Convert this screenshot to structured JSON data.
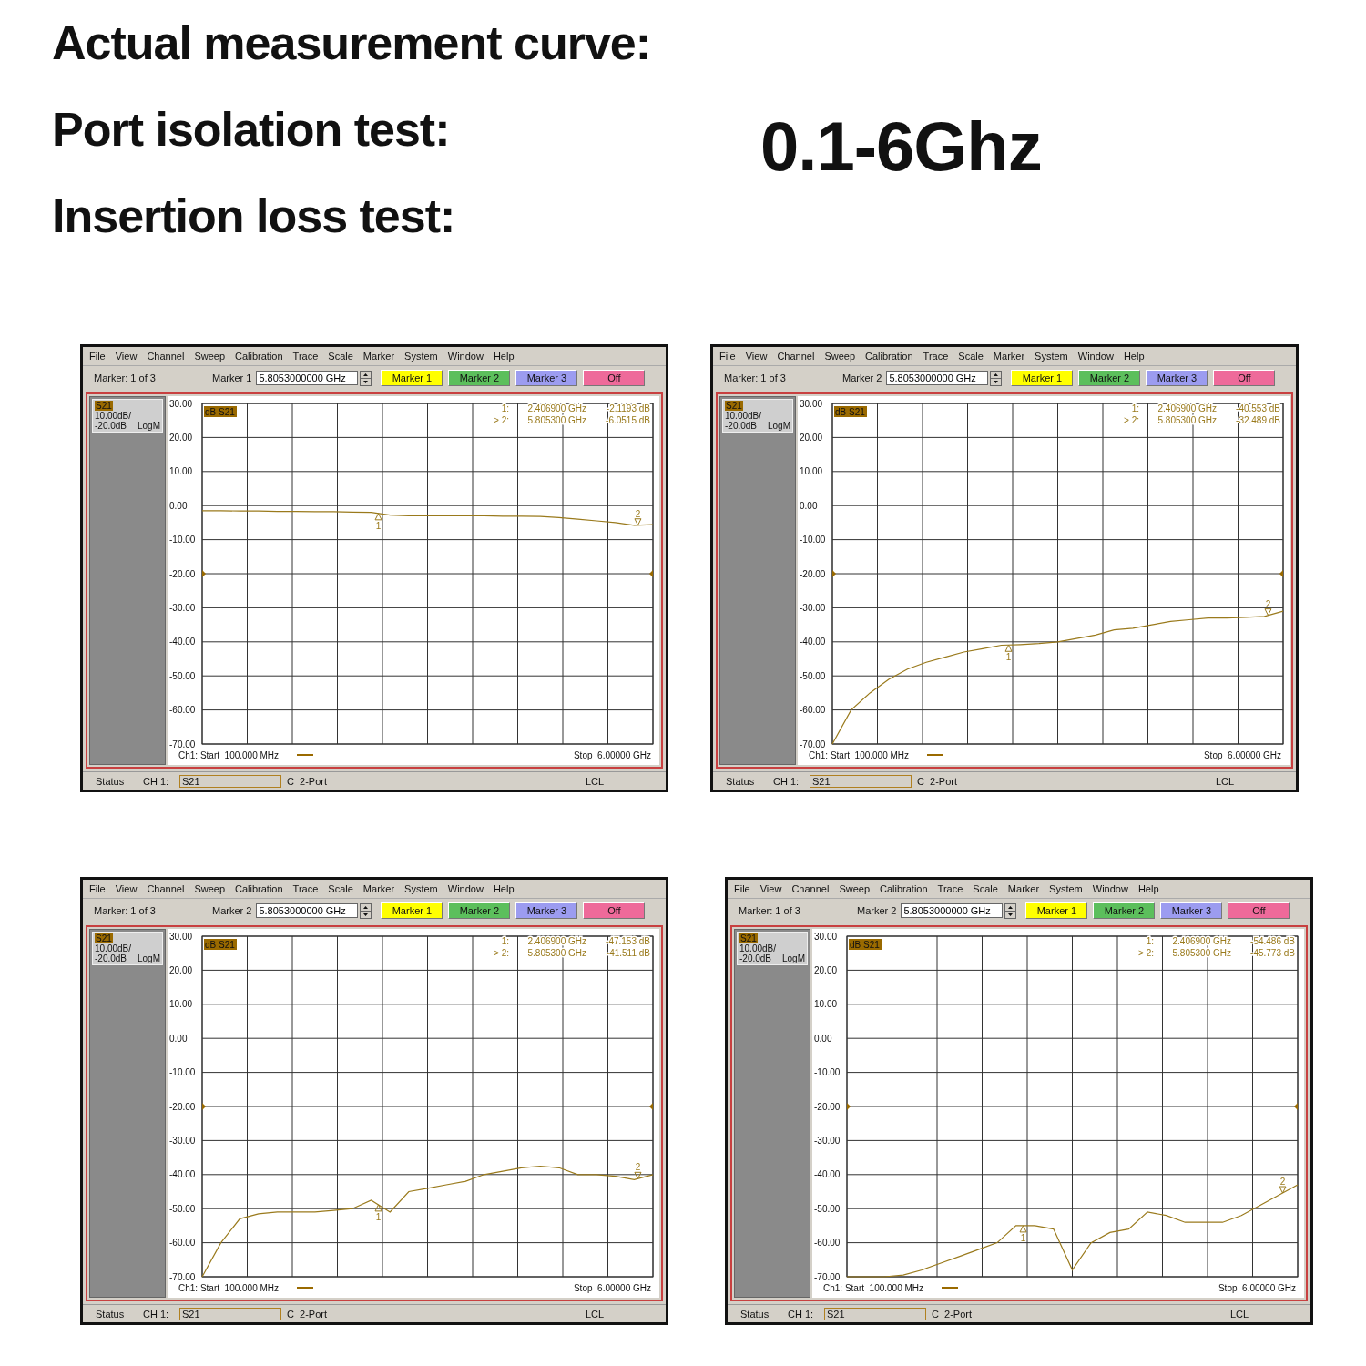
{
  "headings": [
    "Actual measurement curve:",
    "Port isolation test:",
    "Insertion loss test:"
  ],
  "frequency_range": "0.1-6Ghz",
  "analyzers": [
    {
      "menu": [
        "File",
        "View",
        "Channel",
        "Sweep",
        "Calibration",
        "Trace",
        "Scale",
        "Marker",
        "System",
        "Window",
        "Help"
      ],
      "marker_count": "Marker: 1 of 3",
      "marker_field_label": "Marker 1",
      "marker_field_value": "5.8053000000 GHz",
      "marker_buttons": [
        {
          "label": "Marker 1",
          "color": "#ffff00"
        },
        {
          "label": "Marker 2",
          "color": "#5cbf5c"
        },
        {
          "label": "Marker 3",
          "color": "#9c9cf0"
        },
        {
          "label": "Off",
          "color": "#ee6a9a"
        }
      ],
      "scale": "10.00dB/",
      "reference": "-20.0dB",
      "format": "LogM",
      "plot": {
        "trace_tag": "dB S21",
        "readouts": [
          {
            "prefix": "1:",
            "frequency": "2.406900 GHz",
            "value": "-2.1193 dB"
          },
          {
            "prefix": "> 2:",
            "frequency": "5.805300 GHz",
            "value": "-6.0515 dB"
          }
        ],
        "marker_labels": [
          "1",
          "2"
        ],
        "start": "Ch1: Start  100.000 MHz",
        "stop": "Stop  6.00000 GHz",
        "chart_data": {
          "type": "line",
          "grid": true,
          "categories": [
            null,
            null,
            null,
            null,
            null,
            null,
            null,
            null,
            null,
            null,
            null,
            null,
            null,
            null,
            null,
            null,
            null,
            null,
            null,
            null,
            null,
            null,
            null,
            null,
            null
          ],
          "ylim": [
            -70,
            30
          ],
          "yticks": [
            {
              "value": 30,
              "label": "30.00"
            },
            {
              "value": 20,
              "label": "20.00"
            },
            {
              "value": 10,
              "label": "10.00"
            },
            {
              "value": 0,
              "label": "0.00"
            },
            {
              "value": -10,
              "label": "-10.00"
            },
            {
              "value": -20,
              "label": "-20.00"
            },
            {
              "value": -30,
              "label": "-30.00"
            },
            {
              "value": -40,
              "label": "-40.00"
            },
            {
              "value": -50,
              "label": "-50.00"
            },
            {
              "value": -60,
              "label": "-60.00"
            },
            {
              "value": -70,
              "label": "-70.00"
            }
          ],
          "series": [
            {
              "name": "S21",
              "color": "#9a7a1c",
              "values": [
                -1.5,
                -1.5,
                -1.6,
                -1.6,
                -1.7,
                -1.7,
                -1.8,
                -1.8,
                -1.9,
                -2.0,
                -2.8,
                -3.0,
                -3.0,
                -3.0,
                -3.0,
                -3.0,
                -3.1,
                -3.1,
                -3.2,
                -3.5,
                -4.0,
                -4.5,
                -5.0,
                -5.8,
                -5.6
              ]
            }
          ]
        }
      },
      "status": {
        "label": "Status",
        "channel": "CH 1:",
        "measurement": "S21",
        "calibration": "C  2-Port",
        "mode": "LCL"
      }
    },
    {
      "menu": [
        "File",
        "View",
        "Channel",
        "Sweep",
        "Calibration",
        "Trace",
        "Scale",
        "Marker",
        "System",
        "Window",
        "Help"
      ],
      "marker_count": "Marker: 1 of 3",
      "marker_field_label": "Marker 2",
      "marker_field_value": "5.8053000000 GHz",
      "marker_buttons": [
        {
          "label": "Marker 1",
          "color": "#ffff00"
        },
        {
          "label": "Marker 2",
          "color": "#5cbf5c"
        },
        {
          "label": "Marker 3",
          "color": "#9c9cf0"
        },
        {
          "label": "Off",
          "color": "#ee6a9a"
        }
      ],
      "scale": "10.00dB/",
      "reference": "-20.0dB",
      "format": "LogM",
      "plot": {
        "trace_tag": "dB S21",
        "readouts": [
          {
            "prefix": "1:",
            "frequency": "2.406900 GHz",
            "value": "-40.553 dB"
          },
          {
            "prefix": "> 2:",
            "frequency": "5.805300 GHz",
            "value": "-32.489 dB"
          }
        ],
        "marker_labels": [
          "1",
          "2"
        ],
        "start": "Ch1: Start  100.000 MHz",
        "stop": "Stop  6.00000 GHz",
        "chart_data": {
          "type": "line",
          "grid": true,
          "categories": [
            null,
            null,
            null,
            null,
            null,
            null,
            null,
            null,
            null,
            null,
            null,
            null,
            null,
            null,
            null,
            null,
            null,
            null,
            null,
            null,
            null,
            null,
            null,
            null,
            null
          ],
          "ylim": [
            -70,
            30
          ],
          "yticks": [
            {
              "value": 30,
              "label": "30.00"
            },
            {
              "value": 20,
              "label": "20.00"
            },
            {
              "value": 10,
              "label": "10.00"
            },
            {
              "value": 0,
              "label": "0.00"
            },
            {
              "value": -10,
              "label": "-10.00"
            },
            {
              "value": -20,
              "label": "-20.00"
            },
            {
              "value": -30,
              "label": "-30.00"
            },
            {
              "value": -40,
              "label": "-40.00"
            },
            {
              "value": -50,
              "label": "-50.00"
            },
            {
              "value": -60,
              "label": "-60.00"
            },
            {
              "value": -70,
              "label": "-70.00"
            }
          ],
          "series": [
            {
              "name": "S21",
              "color": "#9a7a1c",
              "values": [
                -70,
                -60,
                -55,
                -51,
                -48,
                -46,
                -44.5,
                -43,
                -42,
                -41,
                -40.8,
                -40.5,
                -40,
                -39,
                -38,
                -36.5,
                -36,
                -35,
                -34,
                -33.5,
                -33,
                -33,
                -32.8,
                -32.5,
                -31
              ]
            }
          ]
        }
      },
      "status": {
        "label": "Status",
        "channel": "CH 1:",
        "measurement": "S21",
        "calibration": "C  2-Port",
        "mode": "LCL"
      }
    },
    {
      "menu": [
        "File",
        "View",
        "Channel",
        "Sweep",
        "Calibration",
        "Trace",
        "Scale",
        "Marker",
        "System",
        "Window",
        "Help"
      ],
      "marker_count": "Marker: 1 of 3",
      "marker_field_label": "Marker 2",
      "marker_field_value": "5.8053000000 GHz",
      "marker_buttons": [
        {
          "label": "Marker 1",
          "color": "#ffff00"
        },
        {
          "label": "Marker 2",
          "color": "#5cbf5c"
        },
        {
          "label": "Marker 3",
          "color": "#9c9cf0"
        },
        {
          "label": "Off",
          "color": "#ee6a9a"
        }
      ],
      "scale": "10.00dB/",
      "reference": "-20.0dB",
      "format": "LogM",
      "plot": {
        "trace_tag": "dB S21",
        "readouts": [
          {
            "prefix": "1:",
            "frequency": "2.406900 GHz",
            "value": "-47.153 dB"
          },
          {
            "prefix": "> 2:",
            "frequency": "5.805300 GHz",
            "value": "-41.511 dB"
          }
        ],
        "marker_labels": [
          "1",
          "2"
        ],
        "start": "Ch1: Start  100.000 MHz",
        "stop": "Stop  6.00000 GHz",
        "chart_data": {
          "type": "line",
          "grid": true,
          "categories": [
            null,
            null,
            null,
            null,
            null,
            null,
            null,
            null,
            null,
            null,
            null,
            null,
            null,
            null,
            null,
            null,
            null,
            null,
            null,
            null,
            null,
            null,
            null,
            null,
            null
          ],
          "ylim": [
            -70,
            30
          ],
          "yticks": [
            {
              "value": 30,
              "label": "30.00"
            },
            {
              "value": 20,
              "label": "20.00"
            },
            {
              "value": 10,
              "label": "10.00"
            },
            {
              "value": 0,
              "label": "0.00"
            },
            {
              "value": -10,
              "label": "-10.00"
            },
            {
              "value": -20,
              "label": "-20.00"
            },
            {
              "value": -30,
              "label": "-30.00"
            },
            {
              "value": -40,
              "label": "-40.00"
            },
            {
              "value": -50,
              "label": "-50.00"
            },
            {
              "value": -60,
              "label": "-60.00"
            },
            {
              "value": -70,
              "label": "-70.00"
            }
          ],
          "series": [
            {
              "name": "S21",
              "color": "#9a7a1c",
              "values": [
                -70,
                -60,
                -53,
                -51.5,
                -51,
                -51,
                -51,
                -50.5,
                -50,
                -47.5,
                -51,
                -45,
                -44,
                -43,
                -42,
                -40,
                -39,
                -38,
                -37.5,
                -38,
                -40,
                -40,
                -40.5,
                -41.5,
                -40
              ]
            }
          ]
        }
      },
      "status": {
        "label": "Status",
        "channel": "CH 1:",
        "measurement": "S21",
        "calibration": "C  2-Port",
        "mode": "LCL"
      }
    },
    {
      "menu": [
        "File",
        "View",
        "Channel",
        "Sweep",
        "Calibration",
        "Trace",
        "Scale",
        "Marker",
        "System",
        "Window",
        "Help"
      ],
      "marker_count": "Marker: 1 of 3",
      "marker_field_label": "Marker 2",
      "marker_field_value": "5.8053000000 GHz",
      "marker_buttons": [
        {
          "label": "Marker 1",
          "color": "#ffff00"
        },
        {
          "label": "Marker 2",
          "color": "#5cbf5c"
        },
        {
          "label": "Marker 3",
          "color": "#9c9cf0"
        },
        {
          "label": "Off",
          "color": "#ee6a9a"
        }
      ],
      "scale": "10.00dB/",
      "reference": "-20.0dB",
      "format": "LogM",
      "plot": {
        "trace_tag": "dB S21",
        "readouts": [
          {
            "prefix": "1:",
            "frequency": "2.406900 GHz",
            "value": "-54.486 dB"
          },
          {
            "prefix": "> 2:",
            "frequency": "5.805300 GHz",
            "value": "-45.773 dB"
          }
        ],
        "marker_labels": [
          "1",
          "2"
        ],
        "start": "Ch1: Start  100.000 MHz",
        "stop": "Stop  6.00000 GHz",
        "chart_data": {
          "type": "line",
          "grid": true,
          "categories": [
            null,
            null,
            null,
            null,
            null,
            null,
            null,
            null,
            null,
            null,
            null,
            null,
            null,
            null,
            null,
            null,
            null,
            null,
            null,
            null,
            null,
            null,
            null,
            null,
            null
          ],
          "ylim": [
            -70,
            30
          ],
          "yticks": [
            {
              "value": 30,
              "label": "30.00"
            },
            {
              "value": 20,
              "label": "20.00"
            },
            {
              "value": 10,
              "label": "10.00"
            },
            {
              "value": 0,
              "label": "0.00"
            },
            {
              "value": -10,
              "label": "-10.00"
            },
            {
              "value": -20,
              "label": "-20.00"
            },
            {
              "value": -30,
              "label": "-30.00"
            },
            {
              "value": -40,
              "label": "-40.00"
            },
            {
              "value": -50,
              "label": "-50.00"
            },
            {
              "value": -60,
              "label": "-60.00"
            },
            {
              "value": -70,
              "label": "-70.00"
            }
          ],
          "series": [
            {
              "name": "S21",
              "color": "#9a7a1c",
              "values": [
                -70,
                -70,
                -70,
                -69.5,
                -68,
                -66,
                -64,
                -62,
                -60,
                -55,
                -55,
                -56,
                -68,
                -60,
                -57,
                -56,
                -51,
                -52,
                -54,
                -54,
                -54,
                -52,
                -49,
                -46,
                -43
              ]
            }
          ]
        }
      },
      "status": {
        "label": "Status",
        "channel": "CH 1:",
        "measurement": "S21",
        "calibration": "C  2-Port",
        "mode": "LCL"
      }
    }
  ]
}
